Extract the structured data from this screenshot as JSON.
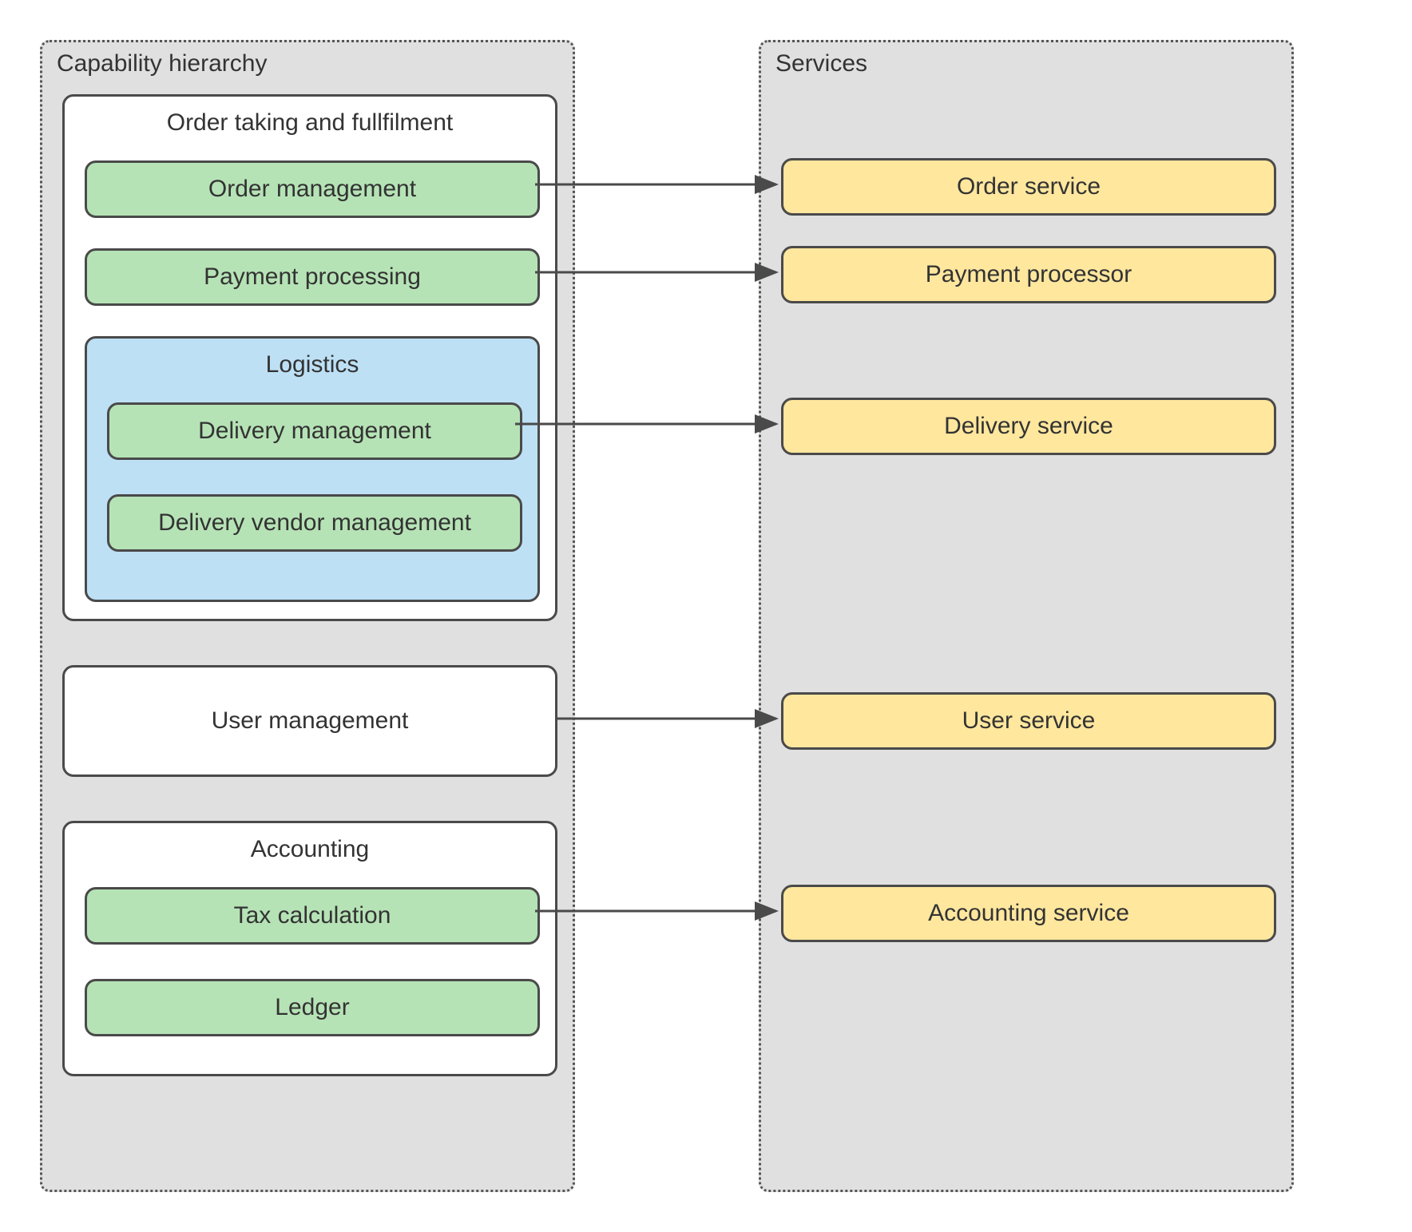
{
  "panels": {
    "capabilities": {
      "title": "Capability hierarchy"
    },
    "services": {
      "title": "Services"
    }
  },
  "capability_groups": {
    "order_fulfilment": {
      "title": "Order taking and fullfilment",
      "items": {
        "order_mgmt": "Order management",
        "payment_proc": "Payment processing",
        "logistics": {
          "title": "Logistics",
          "delivery_mgmt": "Delivery management",
          "delivery_vendor_mgmt": "Delivery vendor management"
        }
      }
    },
    "user_mgmt": {
      "title": "User management"
    },
    "accounting": {
      "title": "Accounting",
      "items": {
        "tax_calc": "Tax calculation",
        "ledger": "Ledger"
      }
    }
  },
  "services": {
    "order": "Order service",
    "payment": "Payment processor",
    "delivery": "Delivery service",
    "user": "User service",
    "accounting": "Accounting service"
  },
  "colors": {
    "panel_bg": "#e0e0e0",
    "white_bg": "#ffffff",
    "green_bg": "#b6e3b6",
    "blue_bg": "#bde0f5",
    "yellow_bg": "#ffe79e",
    "border": "#4a4a4a"
  },
  "mappings": [
    {
      "from": "order_mgmt",
      "to": "order"
    },
    {
      "from": "payment_proc",
      "to": "payment"
    },
    {
      "from": "delivery_mgmt",
      "to": "delivery"
    },
    {
      "from": "user_mgmt",
      "to": "user"
    },
    {
      "from": "tax_calc",
      "to": "accounting"
    }
  ]
}
